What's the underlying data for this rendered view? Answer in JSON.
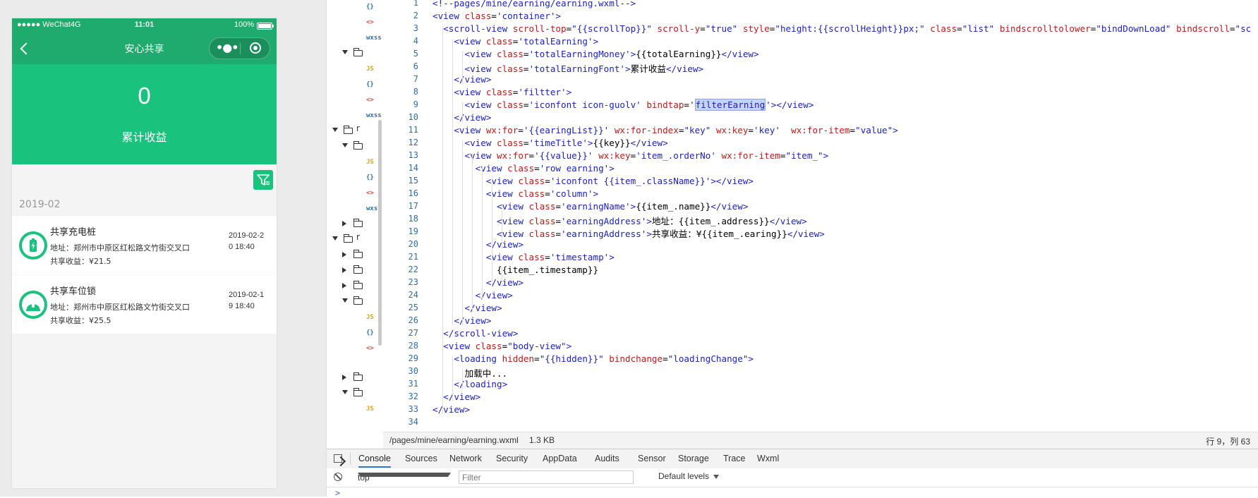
{
  "status_bar": {
    "carrier": "●●●●● WeChat4G",
    "time": "11:01",
    "battery": "100%"
  },
  "nav": {
    "title": "安心共享",
    "more_glyph": "•●•"
  },
  "summary": {
    "total": "0",
    "label": "累计收益"
  },
  "month": "2019-02",
  "earnings": [
    {
      "name": "共享充电桩",
      "address": "地址：郑州市中原区红松路文竹街交叉口",
      "earning": "共享收益：¥21.5",
      "timestamp": "2019-02-20 18:40",
      "icon": "charging-pile-icon"
    },
    {
      "name": "共享车位锁",
      "address": "地址：郑州市中原区红松路文竹街交叉口",
      "earning": "共享收益：¥25.5",
      "timestamp": "2019-02-19 18:40",
      "icon": "parking-lock-icon"
    }
  ],
  "file_tree": {
    "labels": [
      "{}",
      "<>",
      "wxss",
      "JS",
      "{}",
      "<>",
      "wxss",
      "r",
      "JS",
      "{}",
      "<>",
      "wxss",
      "r",
      "JS",
      "{}",
      "<>",
      "JS"
    ]
  },
  "editor": {
    "line_numbers": [
      "1",
      "2",
      "3",
      "4",
      "5",
      "6",
      "7",
      "8",
      "9",
      "10",
      "11",
      "12",
      "13",
      "14",
      "15",
      "16",
      "17",
      "18",
      "19",
      "20",
      "21",
      "22",
      "23",
      "24",
      "25",
      "26",
      "27",
      "28",
      "29",
      "30",
      "31",
      "32",
      "33",
      "34"
    ],
    "lines": [
      [
        {
          "c": "t-comment",
          "t": "<!--pages/mine/earning/earning.wxml-->"
        }
      ],
      [
        {
          "c": "t-tag",
          "t": "<view "
        },
        {
          "c": "t-attr",
          "t": "class"
        },
        {
          "c": "t-text",
          "t": "="
        },
        {
          "c": "t-str",
          "t": "'container'"
        },
        {
          "c": "t-tag",
          "t": ">"
        }
      ],
      [
        {
          "c": "t-text",
          "t": "  "
        },
        {
          "c": "t-tag",
          "t": "<scroll-view "
        },
        {
          "c": "t-attr",
          "t": "scroll-top"
        },
        {
          "c": "t-text",
          "t": "="
        },
        {
          "c": "t-str",
          "t": "\"{{scrollTop}}\" "
        },
        {
          "c": "t-attr",
          "t": "scroll-y"
        },
        {
          "c": "t-text",
          "t": "="
        },
        {
          "c": "t-str",
          "t": "\"true\" "
        },
        {
          "c": "t-attr",
          "t": "style"
        },
        {
          "c": "t-text",
          "t": "="
        },
        {
          "c": "t-str",
          "t": "\"height:{{scrollHeight}}px;\" "
        },
        {
          "c": "t-attr",
          "t": "class"
        },
        {
          "c": "t-text",
          "t": "="
        },
        {
          "c": "t-str",
          "t": "\"list\" "
        },
        {
          "c": "t-attr",
          "t": "bindscrolltolower"
        },
        {
          "c": "t-text",
          "t": "="
        },
        {
          "c": "t-str",
          "t": "\"bindDownLoad\" "
        },
        {
          "c": "t-attr",
          "t": "bindscroll"
        },
        {
          "c": "t-text",
          "t": "="
        },
        {
          "c": "t-str",
          "t": "\"sc"
        }
      ],
      [
        {
          "c": "t-text",
          "t": "    "
        },
        {
          "c": "t-tag",
          "t": "<view "
        },
        {
          "c": "t-attr",
          "t": "class"
        },
        {
          "c": "t-text",
          "t": "="
        },
        {
          "c": "t-str",
          "t": "'totalEarning'"
        },
        {
          "c": "t-tag",
          "t": ">"
        }
      ],
      [
        {
          "c": "t-text",
          "t": "      "
        },
        {
          "c": "t-tag",
          "t": "<view "
        },
        {
          "c": "t-attr",
          "t": "class"
        },
        {
          "c": "t-text",
          "t": "="
        },
        {
          "c": "t-str",
          "t": "'totalEarningMoney'"
        },
        {
          "c": "t-tag",
          "t": ">"
        },
        {
          "c": "t-text",
          "t": "{{totalEarning}}"
        },
        {
          "c": "t-tag",
          "t": "</view>"
        }
      ],
      [
        {
          "c": "t-text",
          "t": "      "
        },
        {
          "c": "t-tag",
          "t": "<view "
        },
        {
          "c": "t-attr",
          "t": "class"
        },
        {
          "c": "t-text",
          "t": "="
        },
        {
          "c": "t-str",
          "t": "'totalEarningFont'"
        },
        {
          "c": "t-tag",
          "t": ">"
        },
        {
          "c": "t-text",
          "t": "累计收益"
        },
        {
          "c": "t-tag",
          "t": "</view>"
        }
      ],
      [
        {
          "c": "t-text",
          "t": "    "
        },
        {
          "c": "t-tag",
          "t": "</view>"
        }
      ],
      [
        {
          "c": "t-text",
          "t": "    "
        },
        {
          "c": "t-tag",
          "t": "<view "
        },
        {
          "c": "t-attr",
          "t": "class"
        },
        {
          "c": "t-text",
          "t": "="
        },
        {
          "c": "t-str",
          "t": "'filtter'"
        },
        {
          "c": "t-tag",
          "t": ">"
        }
      ],
      [
        {
          "c": "t-text",
          "t": "      "
        },
        {
          "c": "t-tag",
          "t": "<view "
        },
        {
          "c": "t-attr",
          "t": "class"
        },
        {
          "c": "t-text",
          "t": "="
        },
        {
          "c": "t-str",
          "t": "'iconfont icon-guolv' "
        },
        {
          "c": "t-attr",
          "t": "bindtap"
        },
        {
          "c": "t-text",
          "t": "="
        },
        {
          "c": "t-str",
          "t": "'"
        },
        {
          "c": "t-str hl",
          "t": "filterEarning"
        },
        {
          "c": "t-str",
          "t": "'"
        },
        {
          "c": "t-tag",
          "t": "></view>"
        }
      ],
      [
        {
          "c": "t-text",
          "t": "    "
        },
        {
          "c": "t-tag",
          "t": "</view>"
        }
      ],
      [
        {
          "c": "t-text",
          "t": "    "
        },
        {
          "c": "t-tag",
          "t": "<view "
        },
        {
          "c": "t-attr",
          "t": "wx:for"
        },
        {
          "c": "t-text",
          "t": "="
        },
        {
          "c": "t-str",
          "t": "'{{earingList}}' "
        },
        {
          "c": "t-attr",
          "t": "wx:for-index"
        },
        {
          "c": "t-text",
          "t": "="
        },
        {
          "c": "t-str",
          "t": "\"key\" "
        },
        {
          "c": "t-attr",
          "t": "wx:key"
        },
        {
          "c": "t-text",
          "t": "="
        },
        {
          "c": "t-str",
          "t": "'key'  "
        },
        {
          "c": "t-attr",
          "t": "wx:for-item"
        },
        {
          "c": "t-text",
          "t": "="
        },
        {
          "c": "t-str",
          "t": "\"value\""
        },
        {
          "c": "t-tag",
          "t": ">"
        }
      ],
      [
        {
          "c": "t-text",
          "t": "      "
        },
        {
          "c": "t-tag",
          "t": "<view "
        },
        {
          "c": "t-attr",
          "t": "class"
        },
        {
          "c": "t-text",
          "t": "="
        },
        {
          "c": "t-str",
          "t": "'timeTitle'"
        },
        {
          "c": "t-tag",
          "t": ">"
        },
        {
          "c": "t-text",
          "t": "{{key}}"
        },
        {
          "c": "t-tag",
          "t": "</view>"
        }
      ],
      [
        {
          "c": "t-text",
          "t": "      "
        },
        {
          "c": "t-tag",
          "t": "<view "
        },
        {
          "c": "t-attr",
          "t": "wx:for"
        },
        {
          "c": "t-text",
          "t": "="
        },
        {
          "c": "t-str",
          "t": "'{{value}}' "
        },
        {
          "c": "t-attr",
          "t": "wx:key"
        },
        {
          "c": "t-text",
          "t": "="
        },
        {
          "c": "t-str",
          "t": "'item_.orderNo' "
        },
        {
          "c": "t-attr",
          "t": "wx:for-item"
        },
        {
          "c": "t-text",
          "t": "="
        },
        {
          "c": "t-str",
          "t": "\"item_\""
        },
        {
          "c": "t-tag",
          "t": ">"
        }
      ],
      [
        {
          "c": "t-text",
          "t": "        "
        },
        {
          "c": "t-tag",
          "t": "<view "
        },
        {
          "c": "t-attr",
          "t": "class"
        },
        {
          "c": "t-text",
          "t": "="
        },
        {
          "c": "t-str",
          "t": "'row earning'"
        },
        {
          "c": "t-tag",
          "t": ">"
        }
      ],
      [
        {
          "c": "t-text",
          "t": "          "
        },
        {
          "c": "t-tag",
          "t": "<view "
        },
        {
          "c": "t-attr",
          "t": "class"
        },
        {
          "c": "t-text",
          "t": "="
        },
        {
          "c": "t-str",
          "t": "'iconfont {{item_.className}}'"
        },
        {
          "c": "t-tag",
          "t": "></view>"
        }
      ],
      [
        {
          "c": "t-text",
          "t": "          "
        },
        {
          "c": "t-tag",
          "t": "<view "
        },
        {
          "c": "t-attr",
          "t": "class"
        },
        {
          "c": "t-text",
          "t": "="
        },
        {
          "c": "t-str",
          "t": "'column'"
        },
        {
          "c": "t-tag",
          "t": ">"
        }
      ],
      [
        {
          "c": "t-text",
          "t": "            "
        },
        {
          "c": "t-tag",
          "t": "<view "
        },
        {
          "c": "t-attr",
          "t": "class"
        },
        {
          "c": "t-text",
          "t": "="
        },
        {
          "c": "t-str",
          "t": "'earningName'"
        },
        {
          "c": "t-tag",
          "t": ">"
        },
        {
          "c": "t-text",
          "t": "{{item_.name}}"
        },
        {
          "c": "t-tag",
          "t": "</view>"
        }
      ],
      [
        {
          "c": "t-text",
          "t": "            "
        },
        {
          "c": "t-tag",
          "t": "<view "
        },
        {
          "c": "t-attr",
          "t": "class"
        },
        {
          "c": "t-text",
          "t": "="
        },
        {
          "c": "t-str",
          "t": "'earningAddress'"
        },
        {
          "c": "t-tag",
          "t": ">"
        },
        {
          "c": "t-text",
          "t": "地址：{{item_.address}}"
        },
        {
          "c": "t-tag",
          "t": "</view>"
        }
      ],
      [
        {
          "c": "t-text",
          "t": "            "
        },
        {
          "c": "t-tag",
          "t": "<view "
        },
        {
          "c": "t-attr",
          "t": "class"
        },
        {
          "c": "t-text",
          "t": "="
        },
        {
          "c": "t-str",
          "t": "'earningAddress'"
        },
        {
          "c": "t-tag",
          "t": ">"
        },
        {
          "c": "t-text",
          "t": "共享收益：¥{{item_.earing}}"
        },
        {
          "c": "t-tag",
          "t": "</view>"
        }
      ],
      [
        {
          "c": "t-text",
          "t": "          "
        },
        {
          "c": "t-tag",
          "t": "</view>"
        }
      ],
      [
        {
          "c": "t-text",
          "t": "          "
        },
        {
          "c": "t-tag",
          "t": "<view "
        },
        {
          "c": "t-attr",
          "t": "class"
        },
        {
          "c": "t-text",
          "t": "="
        },
        {
          "c": "t-str",
          "t": "'timestamp'"
        },
        {
          "c": "t-tag",
          "t": ">"
        }
      ],
      [
        {
          "c": "t-text",
          "t": "            {{item_.timestamp}}"
        }
      ],
      [
        {
          "c": "t-text",
          "t": "          "
        },
        {
          "c": "t-tag",
          "t": "</view>"
        }
      ],
      [
        {
          "c": "t-text",
          "t": "        "
        },
        {
          "c": "t-tag",
          "t": "</view>"
        }
      ],
      [
        {
          "c": "t-text",
          "t": "      "
        },
        {
          "c": "t-tag",
          "t": "</view>"
        }
      ],
      [
        {
          "c": "t-text",
          "t": "    "
        },
        {
          "c": "t-tag",
          "t": "</view>"
        }
      ],
      [
        {
          "c": "t-text",
          "t": "  "
        },
        {
          "c": "t-tag",
          "t": "</scroll-view>"
        }
      ],
      [
        {
          "c": "t-text",
          "t": "  "
        },
        {
          "c": "t-tag",
          "t": "<view "
        },
        {
          "c": "t-attr",
          "t": "class"
        },
        {
          "c": "t-text",
          "t": "="
        },
        {
          "c": "t-str",
          "t": "\"body-view\""
        },
        {
          "c": "t-tag",
          "t": ">"
        }
      ],
      [
        {
          "c": "t-text",
          "t": "    "
        },
        {
          "c": "t-tag",
          "t": "<loading "
        },
        {
          "c": "t-attr",
          "t": "hidden"
        },
        {
          "c": "t-text",
          "t": "="
        },
        {
          "c": "t-str",
          "t": "\"{{hidden}}\" "
        },
        {
          "c": "t-attr",
          "t": "bindchange"
        },
        {
          "c": "t-text",
          "t": "="
        },
        {
          "c": "t-str",
          "t": "\"loadingChange\""
        },
        {
          "c": "t-tag",
          "t": ">"
        }
      ],
      [
        {
          "c": "t-text",
          "t": "      加载中..."
        }
      ],
      [
        {
          "c": "t-text",
          "t": "    "
        },
        {
          "c": "t-tag",
          "t": "</loading>"
        }
      ],
      [
        {
          "c": "t-text",
          "t": "  "
        },
        {
          "c": "t-tag",
          "t": "</view>"
        }
      ],
      [
        {
          "c": "t-tag",
          "t": "</view>"
        }
      ],
      []
    ]
  },
  "editor_status": {
    "path": "/pages/mine/earning/earning.wxml",
    "size": "1.3 KB",
    "cursor": "行 9，列 63"
  },
  "console": {
    "tabs": [
      "Console",
      "Sources",
      "Network",
      "Security",
      "AppData",
      "Audits",
      "Sensor",
      "Storage",
      "Trace",
      "Wxml"
    ],
    "active_tab": "Console",
    "context": "top",
    "filter_placeholder": "Filter",
    "levels": "Default levels",
    "prompt": ">"
  },
  "colors": {
    "brand_green": "#19c37d",
    "nav_green": "#1fab6d",
    "tag_blue": "#1b22c9",
    "attr_red": "#c41a16",
    "line_number_blue": "#2a6fb8"
  }
}
